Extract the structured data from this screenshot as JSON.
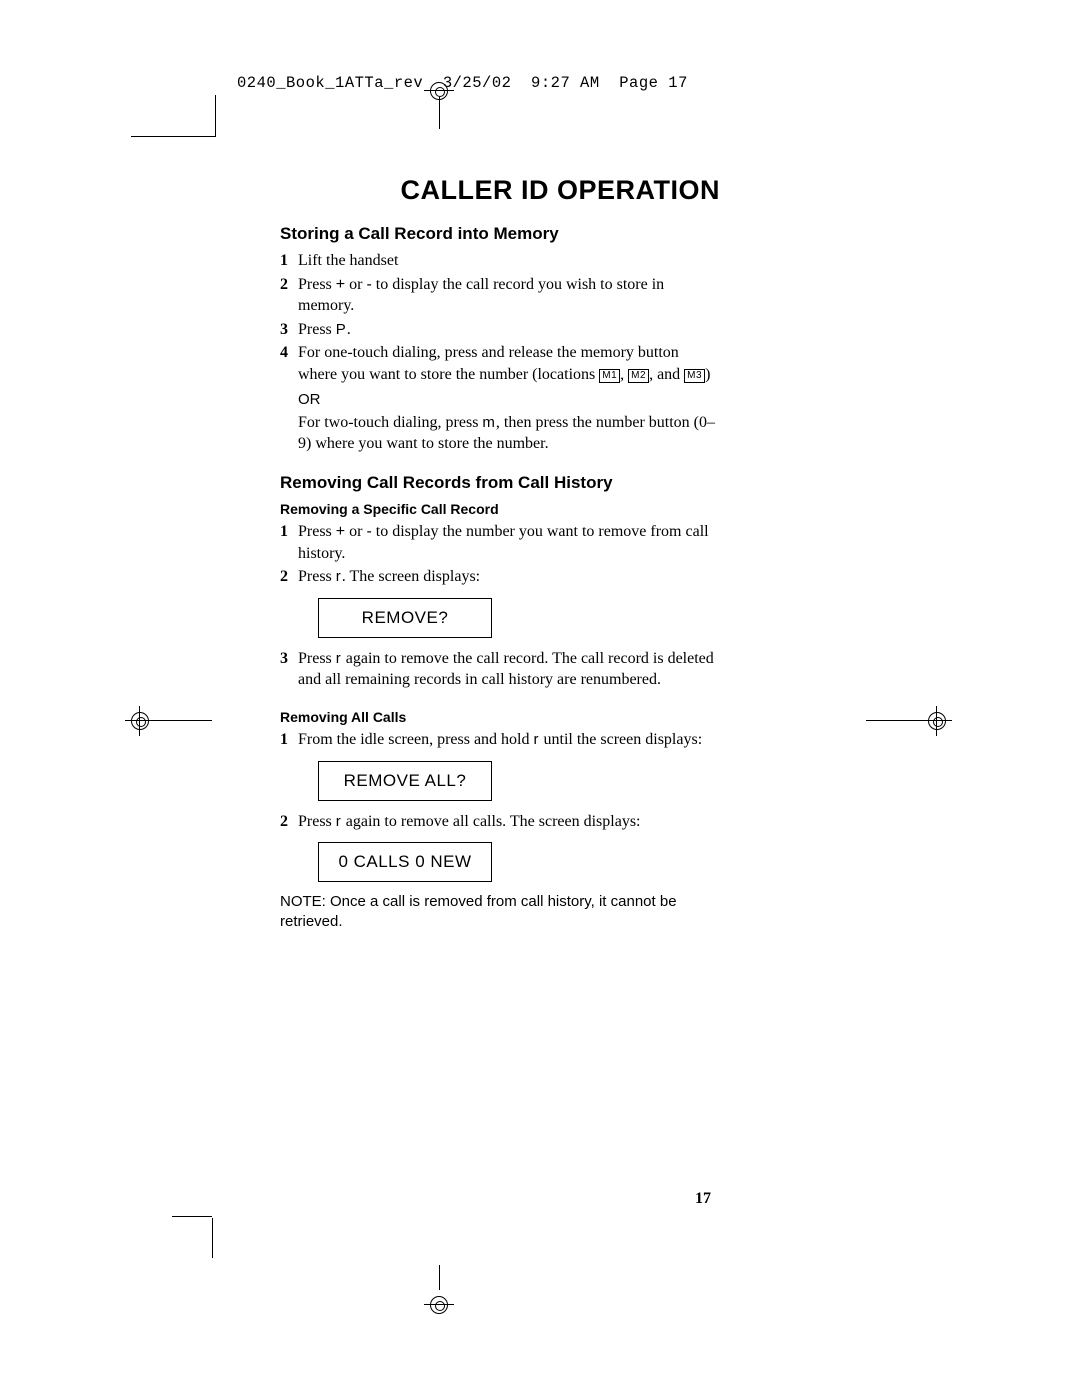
{
  "slug": "0240_Book_1ATTa_rev  3/25/02  9:27 AM  Page 17",
  "title": "CALLER ID OPERATION",
  "page_number": "17",
  "section1": {
    "heading": "Storing a Call Record into Memory",
    "step1_num": "1",
    "step1_txt": "Lift the handset",
    "step2_num": "2",
    "step2_a": "Press ",
    "step2_plus": "+",
    "step2_or": " or ",
    "step2_minus": "-",
    "step2_b": " to display the call record you wish to store in memory.",
    "step3_num": "3",
    "step3_a": "Press ",
    "step3_btn": "P",
    "step3_b": ".",
    "step4_num": "4",
    "step4_a": "For one-touch dialing, press and release the memory button where you want to store the number (locations ",
    "m1": "M1",
    "comma1": ", ",
    "m2": "M2",
    "comma2": ", and ",
    "m3": "M3",
    "close": ")",
    "or_label": "OR",
    "step4_b": "For two-touch dialing, press ",
    "mem_btn": "m",
    "step4_c": ", then press the number button (0–9) where you want to store the number."
  },
  "section2": {
    "heading": "Removing Call Records from Call History",
    "sub1": "Removing a Specific Call Record",
    "s1_step1_num": "1",
    "s1_step1_a": "Press ",
    "s1_plus": "+",
    "s1_or": " or ",
    "s1_minus": "-",
    "s1_step1_b": " to display the number you want to remove from call history.",
    "s1_step2_num": "2",
    "s1_step2_a": "Press ",
    "s1_remove_btn": "r",
    "s1_step2_b": ". The screen displays:",
    "display1": "REMOVE?",
    "s1_step3_num": "3",
    "s1_step3_a": "Press ",
    "s1_step3_btn": "r",
    "s1_step3_b": " again to remove the call record. The call record is deleted and all remaining records in call history are renumbered.",
    "sub2": "Removing All Calls",
    "s2_step1_num": "1",
    "s2_step1_a": "From the idle screen, press and hold ",
    "s2_btn1": "r",
    "s2_step1_b": " until the screen displays:",
    "display2": "REMOVE ALL?",
    "s2_step2_num": "2",
    "s2_step2_a": "Press ",
    "s2_btn2": "r",
    "s2_step2_b": " again to remove all calls. The screen displays:",
    "display3": "0 CALLS  0 NEW",
    "note": "NOTE:  Once a call is removed from call history, it cannot be retrieved."
  }
}
